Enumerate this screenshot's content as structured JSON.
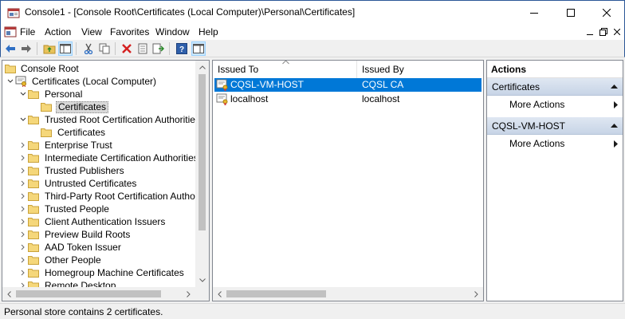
{
  "window": {
    "title": "Console1 - [Console Root\\Certificates (Local Computer)\\Personal\\Certificates]"
  },
  "menu": {
    "items": [
      "File",
      "Action",
      "View",
      "Favorites",
      "Window",
      "Help"
    ]
  },
  "toolbar": {
    "buttons": [
      "back-icon",
      "forward-icon",
      "up-folder-icon",
      "show-hide-tree-icon",
      "cut-icon",
      "copy-icon",
      "delete-icon",
      "properties-icon",
      "export-icon",
      "help-icon",
      "show-hide-action-pane-icon"
    ]
  },
  "tree": {
    "items": [
      {
        "label": "Console Root",
        "icon": "console-root-icon",
        "expander": "none"
      },
      {
        "label": "Certificates (Local Computer)",
        "icon": "certificates-snapin-icon",
        "expander": "expanded"
      },
      {
        "label": "Personal",
        "icon": "folder-open-icon",
        "expander": "expanded"
      },
      {
        "label": "Certificates",
        "icon": "folder-icon",
        "expander": "none",
        "selected": true
      },
      {
        "label": "Trusted Root Certification Authorities",
        "icon": "folder-open-icon",
        "expander": "expanded"
      },
      {
        "label": "Certificates",
        "icon": "folder-icon",
        "expander": "none"
      },
      {
        "label": "Enterprise Trust",
        "icon": "folder-icon",
        "expander": "collapsed"
      },
      {
        "label": "Intermediate Certification Authorities",
        "icon": "folder-icon",
        "expander": "collapsed"
      },
      {
        "label": "Trusted Publishers",
        "icon": "folder-icon",
        "expander": "collapsed"
      },
      {
        "label": "Untrusted Certificates",
        "icon": "folder-icon",
        "expander": "collapsed"
      },
      {
        "label": "Third-Party Root Certification Authorities",
        "icon": "folder-icon",
        "expander": "collapsed"
      },
      {
        "label": "Trusted People",
        "icon": "folder-icon",
        "expander": "collapsed"
      },
      {
        "label": "Client Authentication Issuers",
        "icon": "folder-icon",
        "expander": "collapsed"
      },
      {
        "label": "Preview Build Roots",
        "icon": "folder-icon",
        "expander": "collapsed"
      },
      {
        "label": "AAD Token Issuer",
        "icon": "folder-icon",
        "expander": "collapsed"
      },
      {
        "label": "Other People",
        "icon": "folder-icon",
        "expander": "collapsed"
      },
      {
        "label": "Homegroup Machine Certificates",
        "icon": "folder-icon",
        "expander": "collapsed"
      },
      {
        "label": "Remote Desktop",
        "icon": "folder-icon",
        "expander": "collapsed"
      }
    ]
  },
  "list": {
    "columns": [
      "Issued To",
      "Issued By"
    ],
    "rows": [
      {
        "issued_to": "CQSL-VM-HOST",
        "issued_by": "CQSL CA",
        "icon": "certificate-key-icon",
        "selected": true
      },
      {
        "issued_to": "localhost",
        "issued_by": "localhost",
        "icon": "certificate-key-icon",
        "selected": false
      }
    ]
  },
  "actions": {
    "title": "Actions",
    "sections": [
      {
        "heading": "Certificates",
        "items": [
          "More Actions"
        ]
      },
      {
        "heading": "CQSL-VM-HOST",
        "items": [
          "More Actions"
        ]
      }
    ]
  },
  "status": {
    "text": "Personal store contains 2 certificates."
  },
  "colors": {
    "selection": "#0078d7",
    "action_header": "#c7d4e6",
    "window_border": "#2b5797"
  }
}
